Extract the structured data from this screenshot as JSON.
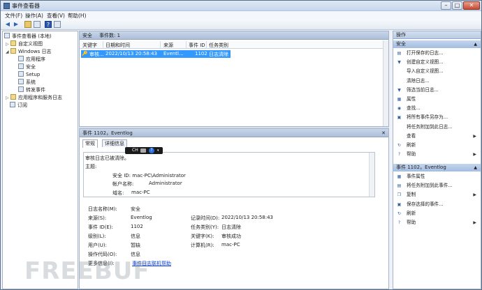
{
  "window": {
    "title": "事件查看器"
  },
  "menu": [
    {
      "label": "文件(F)"
    },
    {
      "label": "操作(A)"
    },
    {
      "label": "查看(V)"
    },
    {
      "label": "帮助(H)"
    }
  ],
  "tree": [
    {
      "label": "事件查看器 (本地)",
      "icon": "event-viewer-icon"
    },
    {
      "label": "自定义视图",
      "icon": "folder-icon"
    },
    {
      "label": "Windows 日志",
      "icon": "folder-icon"
    },
    {
      "label": "应用程序",
      "icon": "log-icon"
    },
    {
      "label": "安全",
      "icon": "log-icon"
    },
    {
      "label": "Setup",
      "icon": "log-icon"
    },
    {
      "label": "系统",
      "icon": "log-icon"
    },
    {
      "label": "转发事件",
      "icon": "log-icon"
    },
    {
      "label": "应用程序和服务日志",
      "icon": "folder-icon"
    },
    {
      "label": "订阅",
      "icon": "subscription-icon"
    }
  ],
  "log": {
    "name": "安全",
    "count_label": "事件数: 1"
  },
  "grid": {
    "columns": [
      "关键字",
      "日期和时间",
      "来源",
      "事件 ID",
      "任务类别"
    ],
    "rows": [
      {
        "keyword": "审核...",
        "datetime": "2022/10/13 20:58:43",
        "source": "Eventl...",
        "event_id": "1102",
        "category": "日志清除"
      }
    ]
  },
  "detail": {
    "header": "事件 1102，Eventlog",
    "tabs": [
      "常规",
      "详细信息"
    ],
    "description": [
      "审核日志已被清除。",
      "主题:",
      "安全 ID:  mac-PC\\Administrator",
      "帐户名称:",
      "Administrator",
      "域名:",
      "mac-PC"
    ],
    "fields_left": [
      {
        "label": "日志名称(M):",
        "value": "安全"
      },
      {
        "label": "来源(S):",
        "value": "Eventlog"
      },
      {
        "label": "事件 ID(E):",
        "value": "1102"
      },
      {
        "label": "级别(L):",
        "value": "信息"
      },
      {
        "label": "用户(U):",
        "value": "暂缺"
      },
      {
        "label": "操作代码(O):",
        "value": "信息"
      },
      {
        "label": "更多信息(I):",
        "value": "事件日志联机帮助"
      }
    ],
    "fields_right": [
      {
        "label": "记录时间(D):",
        "value": "2022/10/13 20:58:43"
      },
      {
        "label": "任务类别(Y):",
        "value": "日志清除"
      },
      {
        "label": "关键字(K):",
        "value": "审核成功"
      },
      {
        "label": "计算机(R):",
        "value": "mac-PC"
      }
    ]
  },
  "overlay": {
    "label": "CH"
  },
  "actions": {
    "title": "操作",
    "section1": "安全",
    "items1": [
      {
        "label": "打开保存的日志...",
        "icon": "open-log-icon",
        "submenu": false
      },
      {
        "label": "创建自定义视图...",
        "icon": "filter-icon",
        "submenu": false
      },
      {
        "label": "导入自定义视图...",
        "icon": "blank-icon",
        "submenu": false
      },
      {
        "label": "清除日志...",
        "icon": "blank-icon",
        "submenu": false
      },
      {
        "label": "筛选当前日志...",
        "icon": "filter-icon",
        "submenu": false
      },
      {
        "label": "属性",
        "icon": "properties-icon",
        "submenu": false
      },
      {
        "label": "查找...",
        "icon": "find-icon",
        "submenu": false
      },
      {
        "label": "将所有事件另存为...",
        "icon": "save-icon",
        "submenu": false
      },
      {
        "label": "将任务附加到此日志...",
        "icon": "blank-icon",
        "submenu": false
      },
      {
        "label": "查看",
        "icon": "blank-icon",
        "submenu": true
      },
      {
        "label": "刷新",
        "icon": "refresh-icon",
        "submenu": false
      },
      {
        "label": "帮助",
        "icon": "help-icon",
        "submenu": true
      }
    ],
    "section2": "事件 1102，Eventlog",
    "items2": [
      {
        "label": "事件属性",
        "icon": "properties-icon",
        "submenu": false
      },
      {
        "label": "将任务附加到此事件...",
        "icon": "task-icon",
        "submenu": false
      },
      {
        "label": "复制",
        "icon": "copy-icon",
        "submenu": true
      },
      {
        "label": "保存选择的事件...",
        "icon": "save-icon",
        "submenu": false
      },
      {
        "label": "刷新",
        "icon": "refresh-icon",
        "submenu": false
      },
      {
        "label": "帮助",
        "icon": "help-icon",
        "submenu": true
      }
    ]
  },
  "watermark": "FREEBUF",
  "colors": {
    "selection": "#3399ff",
    "link": "#0b3fd8",
    "header": "#aebfd8"
  }
}
